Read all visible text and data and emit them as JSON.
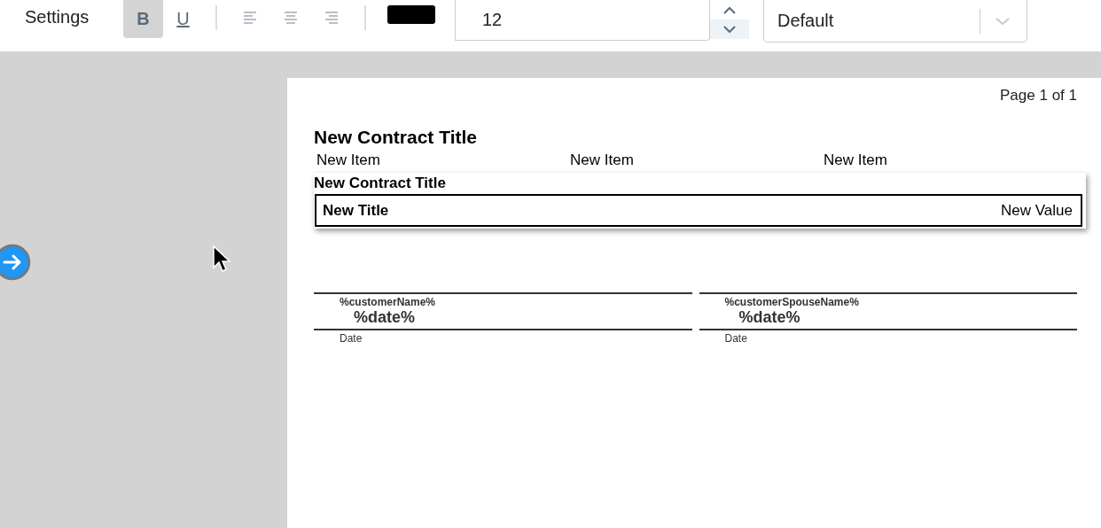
{
  "toolbar": {
    "title": "Settings",
    "format_buttons": [
      {
        "kind": "bold",
        "label": "B",
        "selected": true
      },
      {
        "kind": "underline",
        "label": "U",
        "selected": false
      }
    ],
    "align_buttons": [
      {
        "kind": "left",
        "selected": false
      },
      {
        "kind": "center",
        "selected": false
      },
      {
        "kind": "right",
        "selected": false
      }
    ],
    "text_color": {
      "color": "#000000"
    },
    "font_size": {
      "value": "12"
    },
    "font_family": {
      "value": "Default"
    }
  },
  "document": {
    "page_label": "Page 1 of 1",
    "title": "New Contract Title",
    "items": [
      "New Item",
      "New Item",
      "New Item"
    ],
    "section": {
      "title": "New Contract Title",
      "row": {
        "title": "New Title",
        "value": "New Value"
      }
    },
    "signatures": [
      {
        "name": "%customerName%",
        "date": "%date%",
        "label": "Date"
      },
      {
        "name": "%customerSpouseName%",
        "date": "%date%",
        "label": "Date"
      }
    ]
  }
}
